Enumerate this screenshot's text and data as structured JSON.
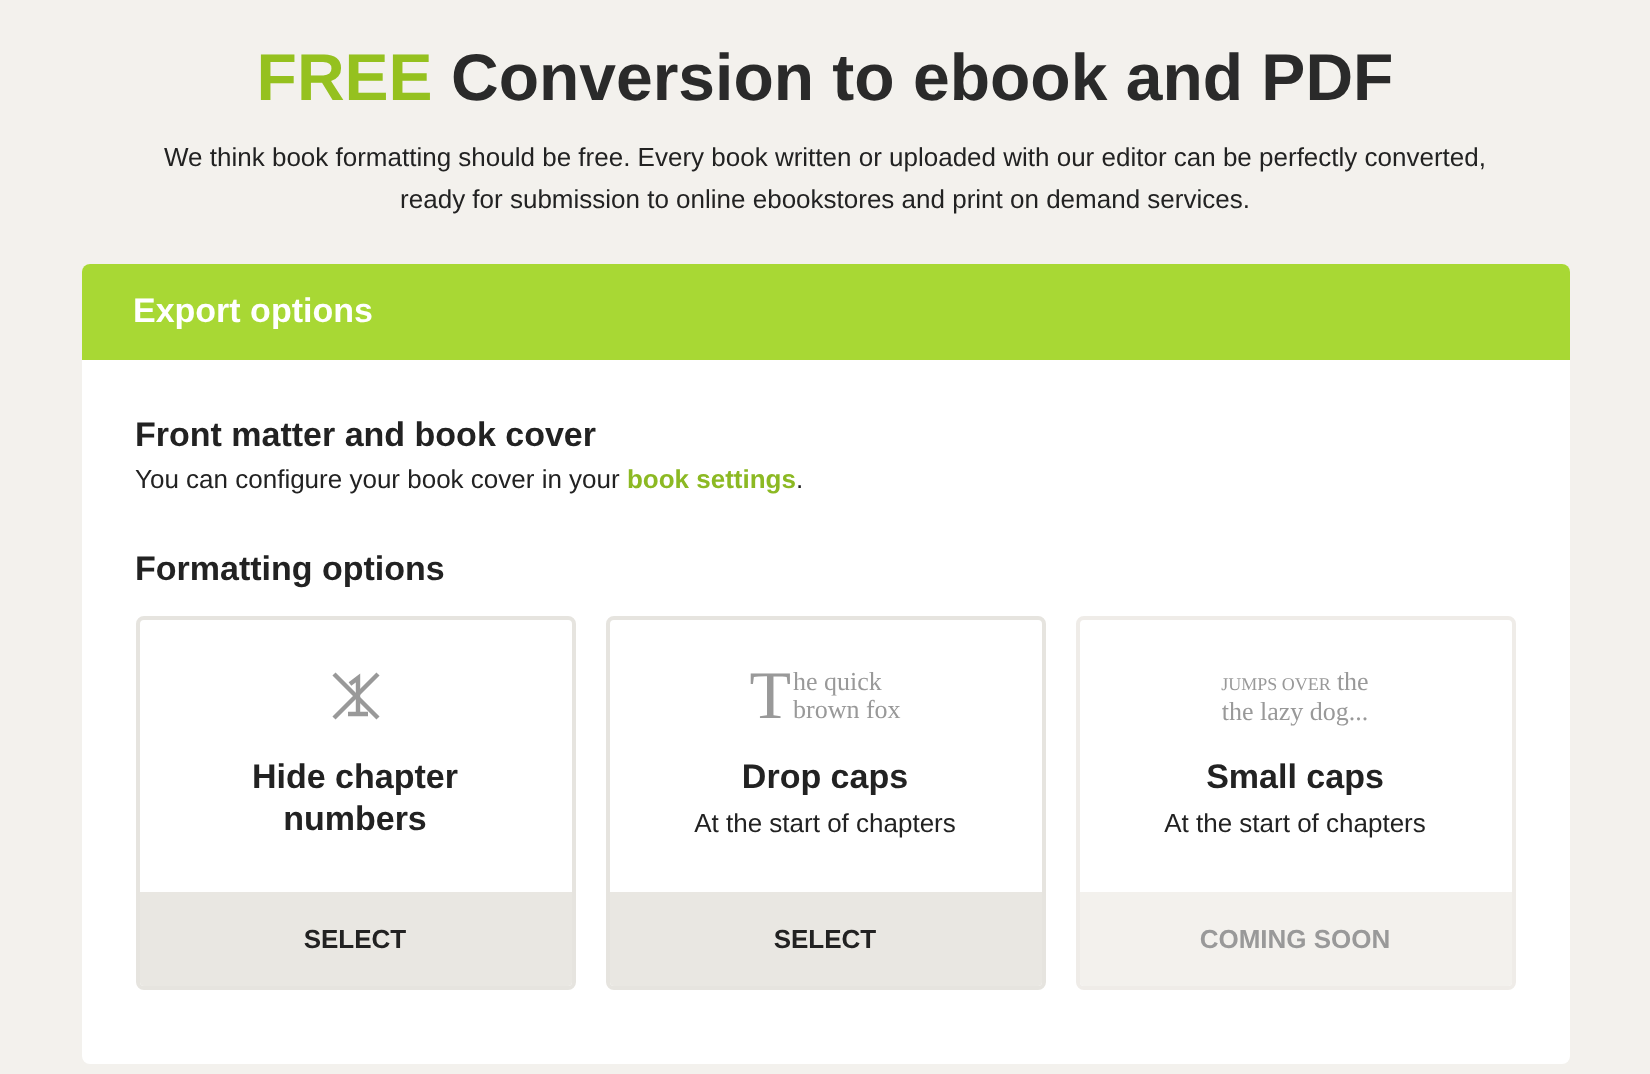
{
  "heading": {
    "highlight": "FREE",
    "rest": "Conversion to ebook and PDF"
  },
  "intro": "We think book formatting should be free. Every book written or uploaded with our editor can be perfectly converted, ready for submission to online ebookstores and print on demand services.",
  "panel": {
    "title": "Export options",
    "sections": [
      {
        "title": "Front matter and book cover",
        "text_before": "You can configure your book cover in your ",
        "link": "book settings",
        "text_after": "."
      },
      {
        "title": "Formatting options"
      }
    ],
    "cards": [
      {
        "kind": "hide-numbers",
        "title": "Hide chapter numbers",
        "button": "SELECT",
        "disabled": false
      },
      {
        "kind": "drop-caps",
        "preview": [
          "T",
          "he quick",
          "brown fox"
        ],
        "title": "Drop caps",
        "subtitle": "At the start of chapters",
        "button": "SELECT",
        "disabled": false
      },
      {
        "kind": "small-caps",
        "preview": [
          "JUMPS OVER",
          "the",
          "the lazy dog..."
        ],
        "title": "Small caps",
        "subtitle": "At the start of chapters",
        "button": "COMING SOON",
        "disabled": true
      }
    ]
  }
}
